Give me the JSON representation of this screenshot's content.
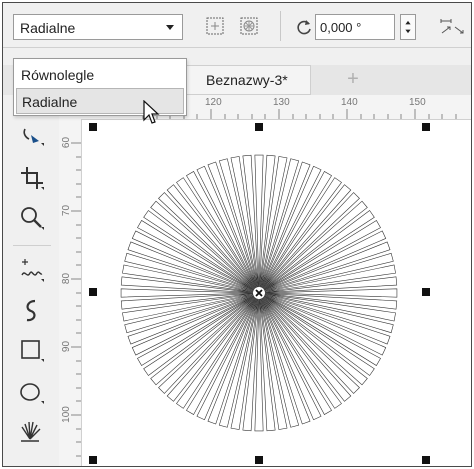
{
  "toolbar": {
    "fill_type_value": "Radialne",
    "rotation_value": "0,000 °"
  },
  "dropdown": {
    "options": [
      "Równolegle",
      "Radialne"
    ],
    "selected_index": 1
  },
  "tabs": {
    "document": "Beznazwy-3*",
    "add": "+"
  },
  "ruler": {
    "horizontal": [
      "120",
      "130",
      "140",
      "150"
    ],
    "vertical": [
      "60",
      "70",
      "80",
      "90",
      "100"
    ]
  },
  "toolbox": {
    "tools": [
      "shape-tool-icon",
      "crop-tool-icon",
      "zoom-tool-icon",
      "freehand-tool-icon",
      "artistic-media-icon",
      "rectangle-tool-icon",
      "ellipse-tool-icon",
      "interactive-fill-icon"
    ]
  },
  "canvas": {
    "object": "radial-starburst",
    "ray_count": 72
  }
}
